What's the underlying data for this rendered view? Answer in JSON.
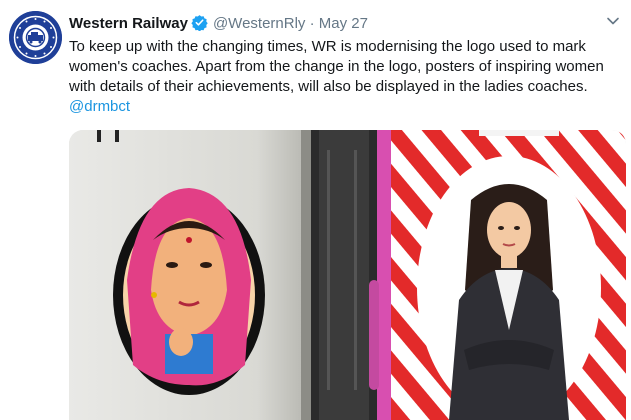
{
  "tweet": {
    "author_name": "Western Railway",
    "handle": "@WesternRly",
    "separator": "·",
    "date": "May 27",
    "text": "To keep up with the changing times, WR is modernising the logo used to mark women's coaches. Apart from the change in the logo, posters of inspiring women with details of their achievements, will also be displayed in the ladies coaches.",
    "mention": "@drmbct"
  },
  "avatar": {
    "logo_arc_text": "INDIAN RAILWAYS",
    "logo_glyph": "भारतीय रेल"
  },
  "icons": {
    "verified": "verified-badge-icon",
    "menu": "chevron-down-icon"
  },
  "colors": {
    "brand_blue": "#1f3f98",
    "verified_blue": "#1da1f2",
    "link_blue": "#1b95e0",
    "muted_gray": "#657786",
    "stripe_red": "#e32a2a",
    "door_pink": "#d84fb0"
  }
}
